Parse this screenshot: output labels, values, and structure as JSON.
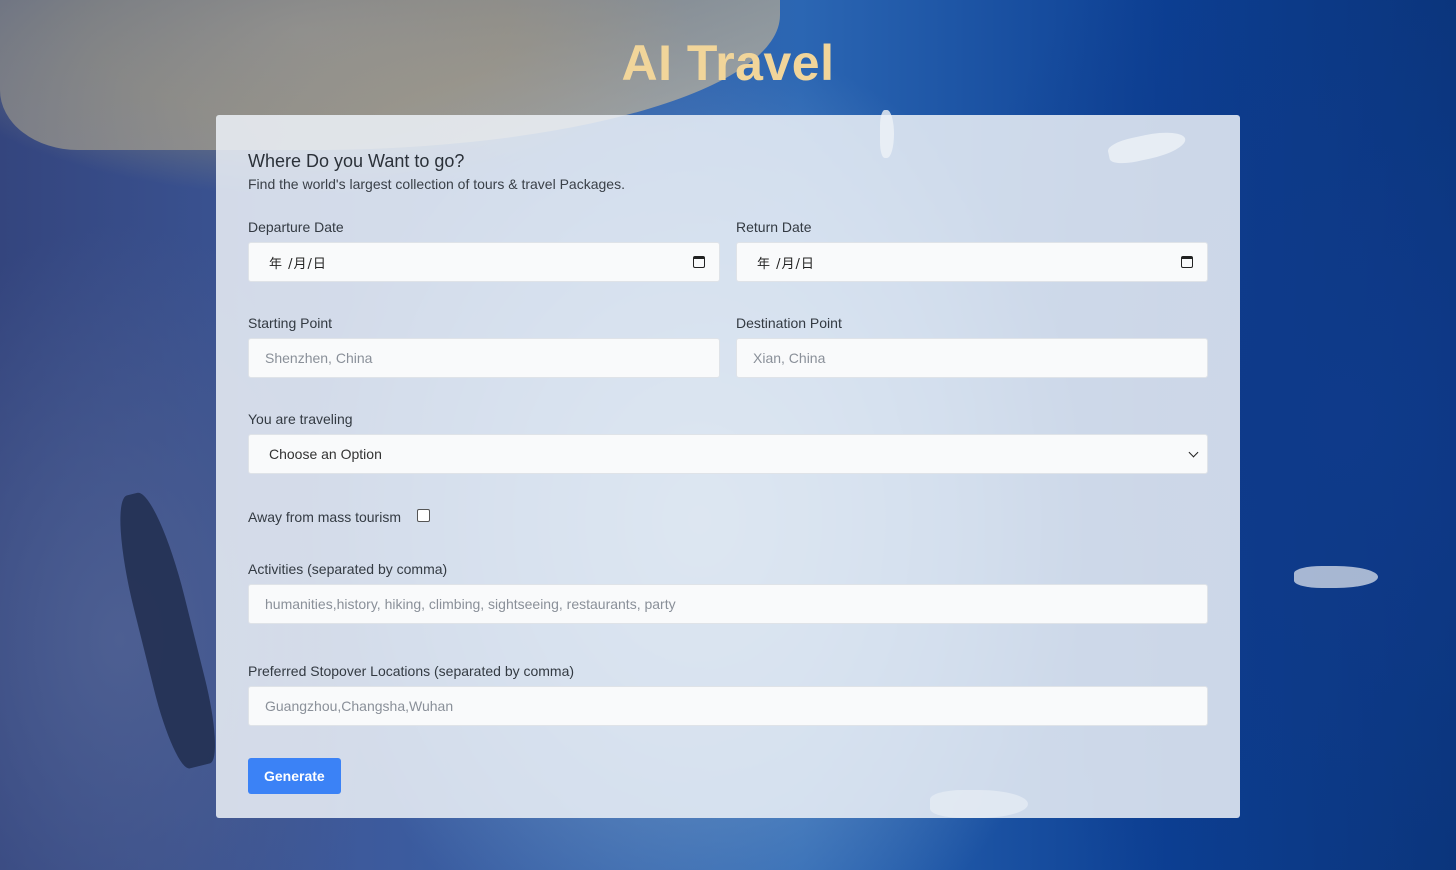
{
  "app": {
    "title": "AI Travel"
  },
  "form": {
    "heading": "Where Do you Want to go?",
    "subheading": "Find the world's largest collection of tours & travel Packages.",
    "departure_date": {
      "label": "Departure Date",
      "value": "年 /月/日"
    },
    "return_date": {
      "label": "Return Date",
      "value": "年 /月/日"
    },
    "starting_point": {
      "label": "Starting Point",
      "placeholder": "Shenzhen, China",
      "value": ""
    },
    "destination_point": {
      "label": "Destination Point",
      "placeholder": "Xian, China",
      "value": ""
    },
    "traveling": {
      "label": "You are traveling",
      "selected": "Choose an Option"
    },
    "mass_tourism": {
      "label": "Away from mass tourism",
      "checked": false
    },
    "activities": {
      "label": "Activities (separated by comma)",
      "placeholder": "humanities,history, hiking, climbing, sightseeing, restaurants, party",
      "value": ""
    },
    "stopovers": {
      "label": "Preferred Stopover Locations (separated by comma)",
      "placeholder": "Guangzhou,Changsha,Wuhan",
      "value": ""
    },
    "generate_label": "Generate"
  },
  "colors": {
    "title": "#f1d59a",
    "button": "#3b82f6",
    "card": "#ecf1f7"
  },
  "icons": {
    "date": "calendar-icon",
    "select": "chevron-down-icon"
  }
}
